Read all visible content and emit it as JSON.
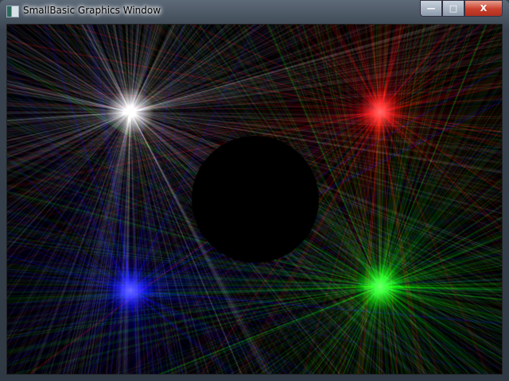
{
  "window": {
    "title": "SmallBasic Graphics Window",
    "minimize_label": "—",
    "maximize_label": "□",
    "close_label": "X"
  },
  "canvas": {
    "background": "#000000",
    "bursts": [
      {
        "name": "white",
        "color": "#ffffff"
      },
      {
        "name": "red",
        "color": "#ff0000"
      },
      {
        "name": "blue",
        "color": "#0000ff"
      },
      {
        "name": "green",
        "color": "#00ff00"
      }
    ],
    "circle_color": "#000000"
  }
}
